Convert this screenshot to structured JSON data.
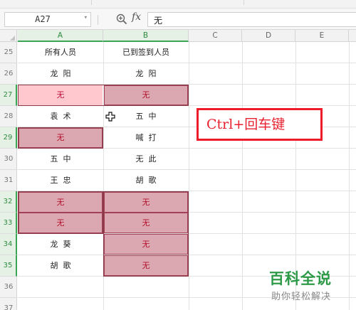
{
  "formula_bar": {
    "name_box": "A27",
    "fx_label": "fx",
    "formula_value": "无"
  },
  "columns": [
    "A",
    "B",
    "C",
    "D",
    "E"
  ],
  "rows": [
    "25",
    "26",
    "27",
    "28",
    "29",
    "30",
    "31",
    "32",
    "33",
    "34",
    "35",
    "36",
    "37"
  ],
  "cells": {
    "A": [
      "所有人员",
      "龙  阳",
      "无",
      "袁  术",
      "无",
      "五  中",
      "王  忠",
      "无",
      "无",
      "龙  葵",
      "胡  歌",
      "",
      ""
    ],
    "B": [
      "已到签到人员",
      "龙  阳",
      "无",
      "五  中",
      "喊  打",
      "无  此",
      "胡  歌",
      "无",
      "无",
      "无",
      "无",
      "",
      ""
    ]
  },
  "annotation": {
    "text": "Ctrl+回车键"
  },
  "watermark": {
    "title": "百科全说",
    "subtitle": "助你轻松解决"
  },
  "colors": {
    "selection_fill": "#dba8b1",
    "active_cell_fill": "#ffc7ce",
    "selected_text": "#b3122d",
    "annotation_red": "#ee1b2a",
    "header_selected_green": "#3aa655",
    "watermark_green": "#2d9a47"
  }
}
